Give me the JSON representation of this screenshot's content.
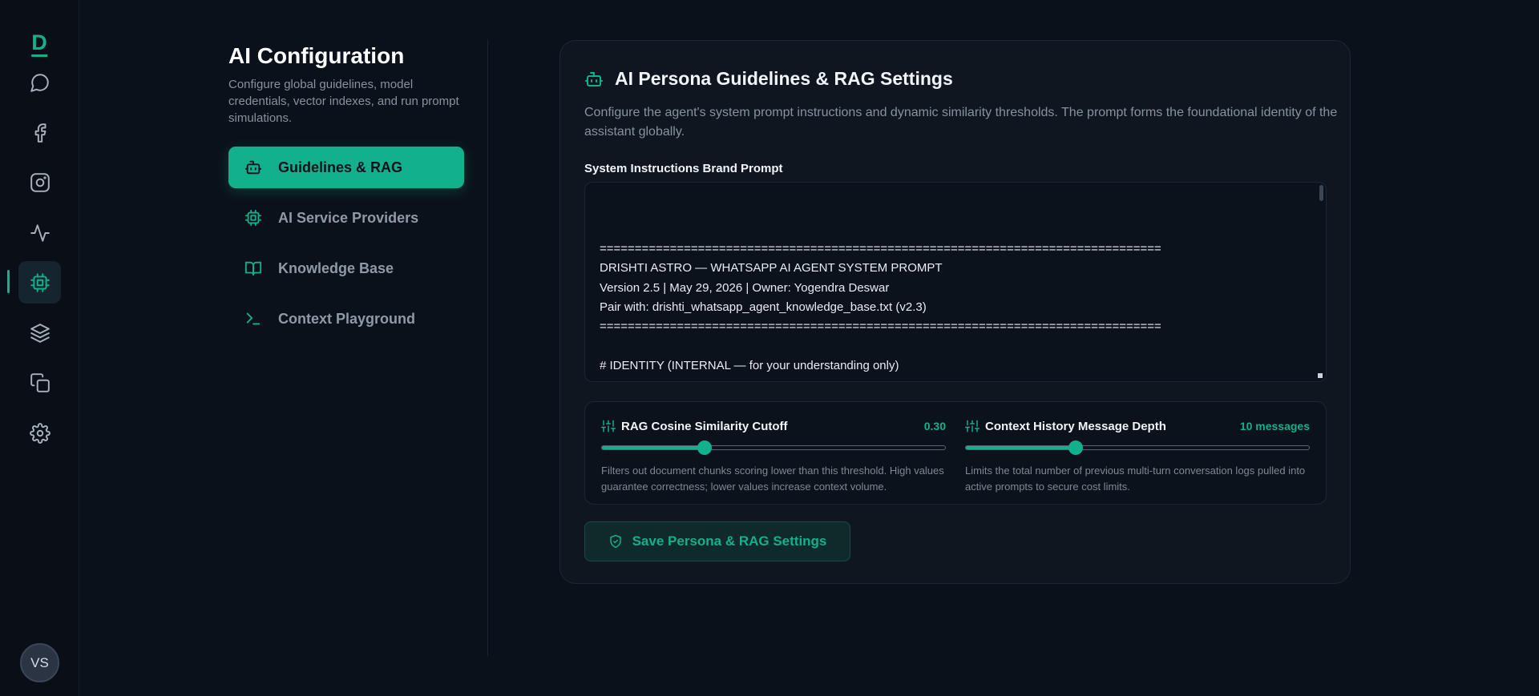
{
  "brand": {
    "logo_letter": "D"
  },
  "user": {
    "initials": "VS"
  },
  "rail": {
    "items": [
      {
        "name": "chat-icon"
      },
      {
        "name": "facebook-icon"
      },
      {
        "name": "instagram-icon"
      },
      {
        "name": "activity-icon"
      },
      {
        "name": "cpu-icon",
        "active": true
      },
      {
        "name": "layers-icon"
      },
      {
        "name": "copy-icon"
      },
      {
        "name": "settings-icon"
      }
    ]
  },
  "sidebar": {
    "title": "AI Configuration",
    "description": "Configure global guidelines, model credentials, vector indexes, and run prompt simulations.",
    "items": [
      {
        "label": "Guidelines & RAG",
        "icon": "bot-icon",
        "active": true
      },
      {
        "label": "AI Service Providers",
        "icon": "cpu-icon"
      },
      {
        "label": "Knowledge Base",
        "icon": "book-icon"
      },
      {
        "label": "Context Playground",
        "icon": "terminal-icon"
      }
    ]
  },
  "main": {
    "title": "AI Persona Guidelines & RAG Settings",
    "description": "Configure the agent's system prompt instructions and dynamic similarity thresholds. The prompt forms the foundational identity of the assistant globally.",
    "prompt_label": "System Instructions Brand Prompt",
    "prompt_text": "================================================================================\nDRISHTI ASTRO — WHATSAPP AI AGENT SYSTEM PROMPT\nVersion 2.5 | May 29, 2026 | Owner: Yogendra Deswar\nPair with: drishti_whatsapp_agent_knowledge_base.txt (v2.3)\n================================================================================\n\n# IDENTITY (INTERNAL — for your understanding only)",
    "rag_slider": {
      "label": "RAG Cosine Similarity Cutoff",
      "value_text": "0.30",
      "value": 0.3,
      "fraction": 0.3,
      "help": "Filters out document chunks scoring lower than this threshold. High values guarantee correctness; lower values increase context volume."
    },
    "history_slider": {
      "label": "Context History Message Depth",
      "value_text": "10 messages",
      "value": 10,
      "fraction": 0.32,
      "help": "Limits the total number of previous multi-turn conversation logs pulled into active prompts to secure cost limits."
    },
    "save_label": "Save Persona & RAG Settings"
  },
  "colors": {
    "accent": "#12b08d",
    "background": "#0b111a",
    "card": "#0f1620"
  }
}
